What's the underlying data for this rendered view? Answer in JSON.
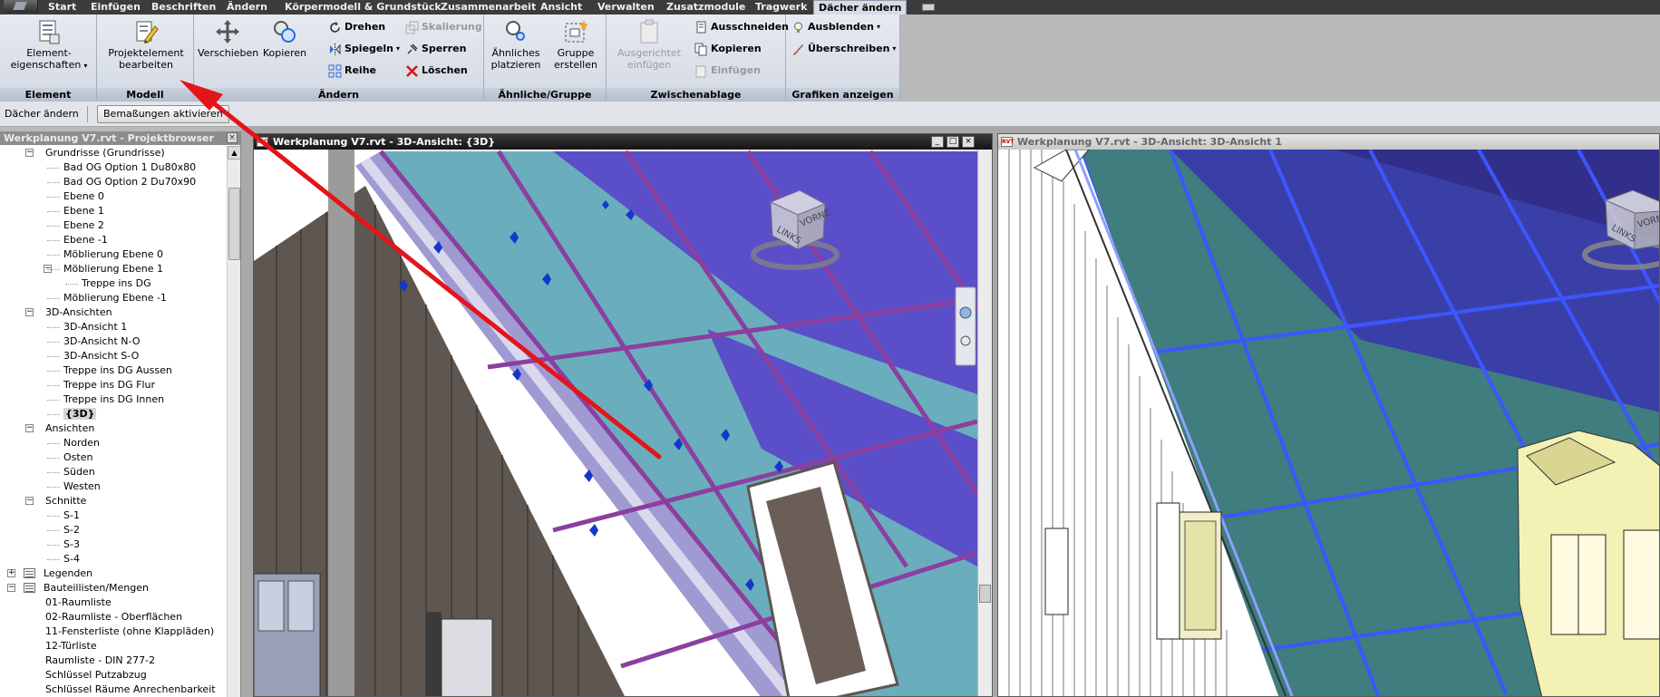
{
  "menu": {
    "tabs": [
      "Start",
      "Einfügen",
      "Beschriften",
      "Ändern",
      "Körpermodell & Grundstück",
      "Zusammenarbeit",
      "Ansicht",
      "Verwalten",
      "Zusatzmodule",
      "Tragwerk",
      "Dächer ändern"
    ],
    "active_tab": "Dächer ändern"
  },
  "ribbon": {
    "element": {
      "panel_label": "Element",
      "properties_line1": "Element-",
      "properties_line2": "eigenschaften"
    },
    "modell": {
      "panel_label": "Modell",
      "edit_line1": "Projektelement",
      "edit_line2": "bearbeiten"
    },
    "aendern": {
      "panel_label": "Ändern",
      "verschieben": "Verschieben",
      "kopieren": "Kopieren",
      "drehen": "Drehen",
      "spiegeln": "Spiegeln",
      "reihe": "Reihe",
      "skalierung": "Skalierung",
      "sperren": "Sperren",
      "loeschen": "Löschen"
    },
    "aehnliche": {
      "panel_label": "Ähnliche/Gruppe",
      "platzieren_line1": "Ähnliches",
      "platzieren_line2": "platzieren",
      "gruppe_line1": "Gruppe",
      "gruppe_line2": "erstellen"
    },
    "zwischenablage": {
      "panel_label": "Zwischenablage",
      "ausgerichtet_line1": "Ausgerichtet",
      "ausgerichtet_line2": "einfügen",
      "ausschneiden": "Ausschneiden",
      "kopieren": "Kopieren",
      "einfuegen": "Einfügen"
    },
    "grafiken": {
      "panel_label": "Grafiken anzeigen",
      "ausblenden": "Ausblenden",
      "ueberschreiben": "Überschreiben"
    }
  },
  "options_bar": {
    "label": "Dächer ändern",
    "button": "Bemaßungen aktivieren"
  },
  "project_browser": {
    "title": "Werkplanung V7.rvt - Projektbrowser",
    "items": [
      {
        "text": "Grundrisse (Grundrisse)"
      },
      {
        "text": "Bad OG Option 1 Du80x80"
      },
      {
        "text": "Bad OG Option 2 Du70x90"
      },
      {
        "text": "Ebene 0"
      },
      {
        "text": "Ebene 1"
      },
      {
        "text": "Ebene 2"
      },
      {
        "text": "Ebene -1"
      },
      {
        "text": "Möblierung Ebene 0"
      },
      {
        "text": "Möblierung Ebene 1"
      },
      {
        "text": "Treppe ins DG"
      },
      {
        "text": "Möblierung Ebene -1"
      },
      {
        "text": "3D-Ansichten"
      },
      {
        "text": "3D-Ansicht 1"
      },
      {
        "text": "3D-Ansicht N-O"
      },
      {
        "text": "3D-Ansicht S-O"
      },
      {
        "text": "Treppe ins DG Aussen"
      },
      {
        "text": "Treppe ins DG Flur"
      },
      {
        "text": "Treppe ins DG Innen"
      },
      {
        "text": "{3D}"
      },
      {
        "text": "Ansichten"
      },
      {
        "text": "Norden"
      },
      {
        "text": "Osten"
      },
      {
        "text": "Süden"
      },
      {
        "text": "Westen"
      },
      {
        "text": "Schnitte"
      },
      {
        "text": "S-1"
      },
      {
        "text": "S-2"
      },
      {
        "text": "S-3"
      },
      {
        "text": "S-4"
      },
      {
        "text": "Legenden"
      },
      {
        "text": "Bauteillisten/Mengen"
      },
      {
        "text": "01-Raumliste"
      },
      {
        "text": "02-Raumliste - Oberflächen"
      },
      {
        "text": "11-Fensterliste (ohne Klappläden)"
      },
      {
        "text": "12-Türliste"
      },
      {
        "text": "Raumliste - DIN 277-2"
      },
      {
        "text": "Schlüssel Putzabzug"
      },
      {
        "text": "Schlüssel Räume Anrechenbarkeit"
      }
    ]
  },
  "views": {
    "active": {
      "title": "Werkplanung V7.rvt - 3D-Ansicht: {3D}",
      "viewcube_left": "LINKS",
      "viewcube_front": "VORNE"
    },
    "secondary": {
      "title": "Werkplanung V7.rvt - 3D-Ansicht: 3D-Ansicht 1",
      "viewcube_left": "LINKS",
      "viewcube_front": "VORNE"
    }
  },
  "colors": {
    "annotation_arrow": "#e4141b",
    "roof_panel_light": "#6aaebd",
    "roof_panel_dark": "#5a4fc8",
    "roof_frame": "#8b3f9f",
    "roof_panel_teal": "#3f7d7e",
    "roof_frame_blue": "#3d56ff",
    "facade_brown": "#5e5650",
    "dormer_yellow": "#f4f1b5"
  }
}
